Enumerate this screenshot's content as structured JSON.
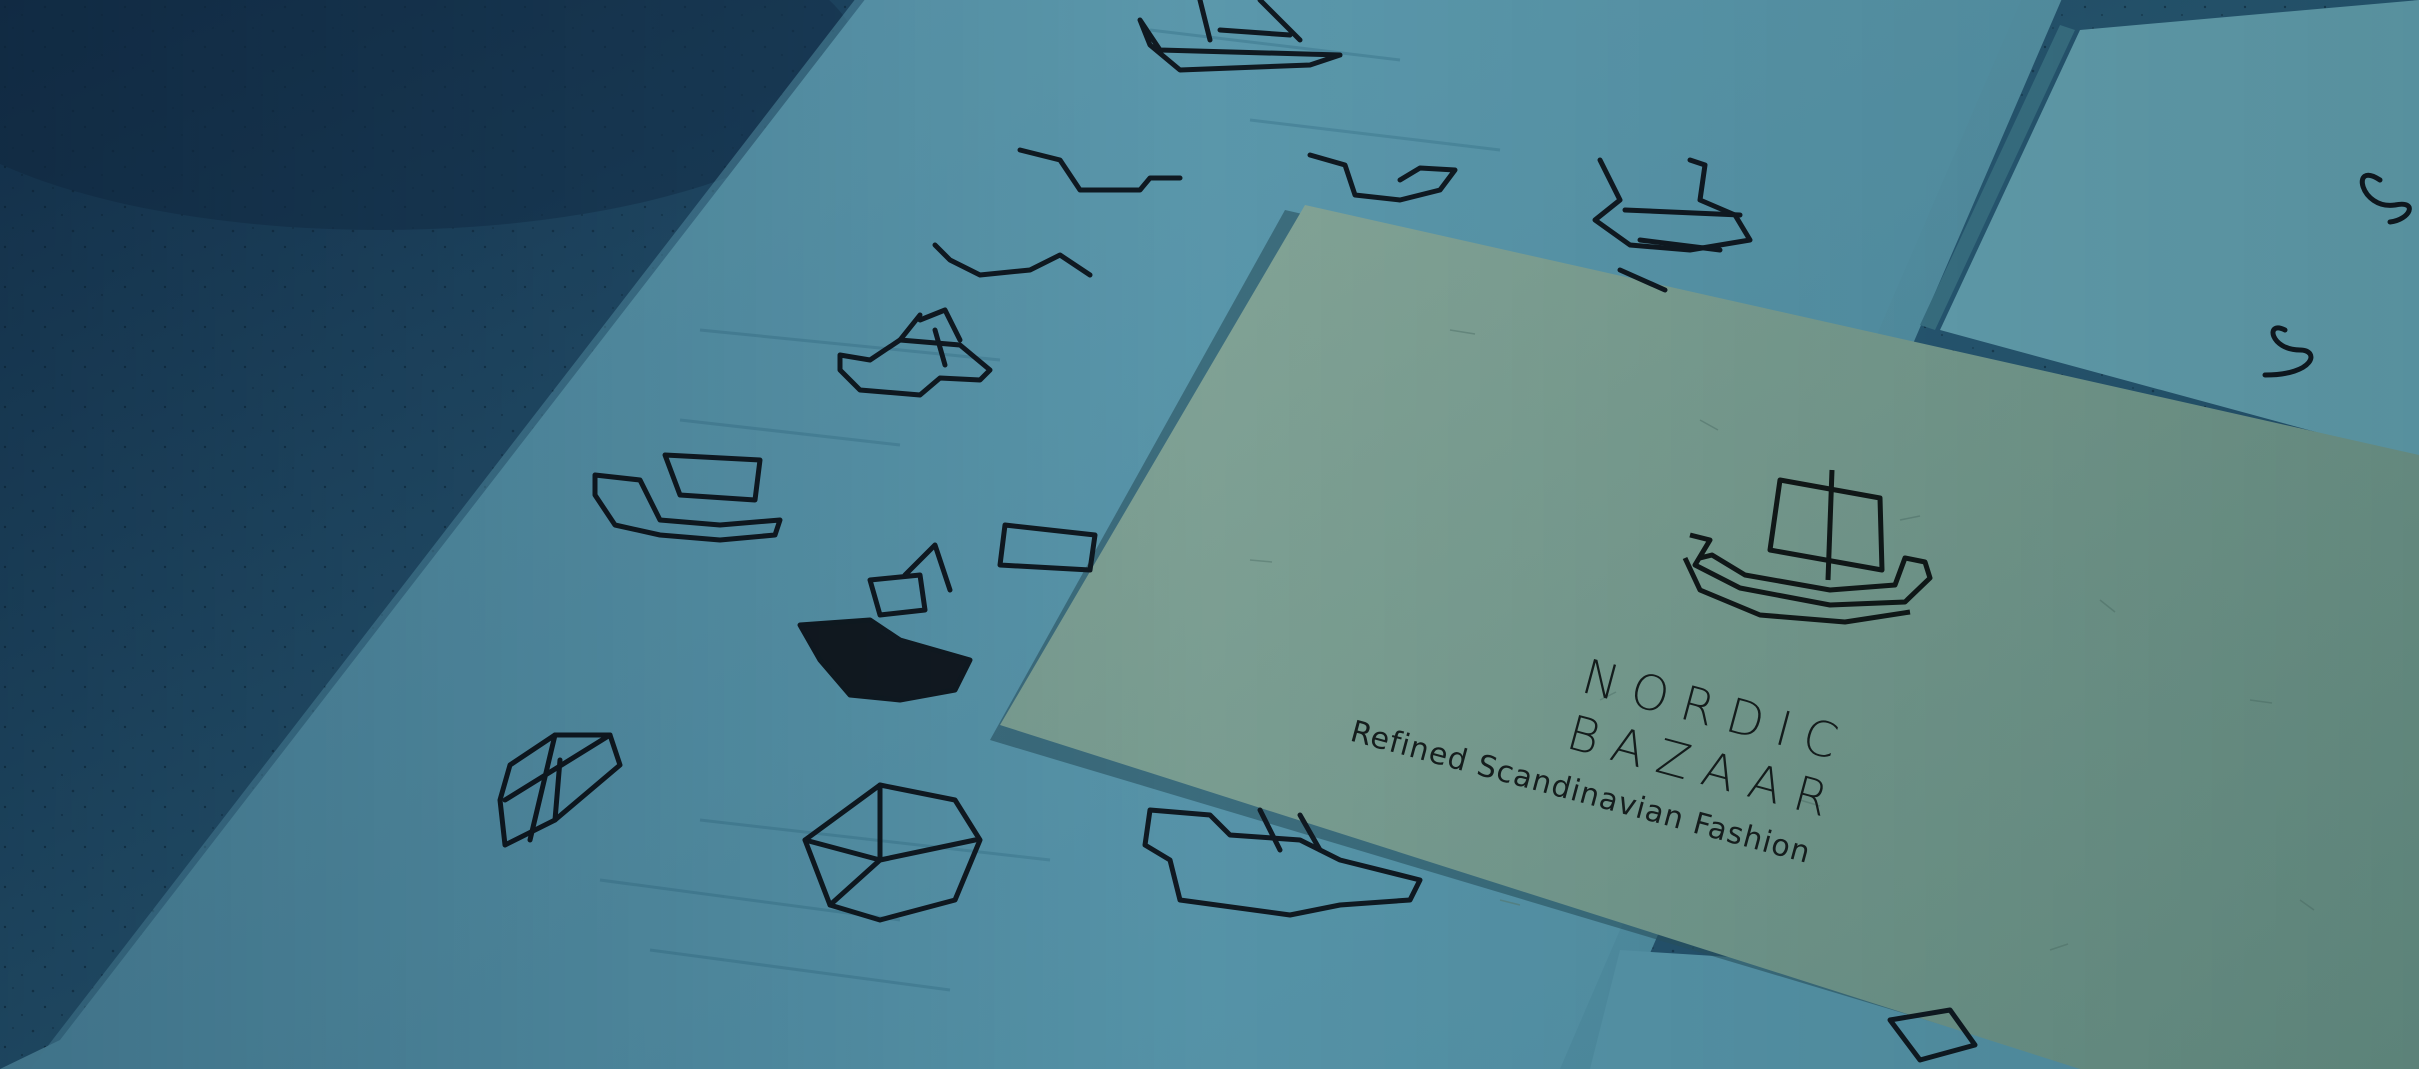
{
  "photo": {
    "subject": "",
    "palette": {
      "background": "#1f4a63",
      "paper": "#5f9aa8",
      "card": "#7fa49a",
      "ink": "#121a1f"
    }
  },
  "card": {
    "brand_line_1": "NORDIC",
    "brand_line_2": "BAZAAR",
    "tagline": "Refined Scandinavian Fashion",
    "logo_icon": "viking-ship-icon"
  }
}
